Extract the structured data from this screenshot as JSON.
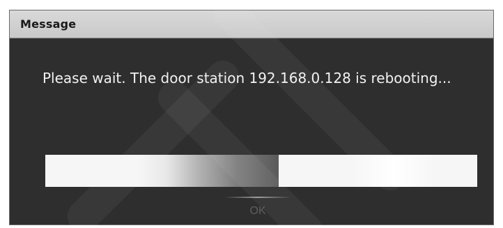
{
  "dialog": {
    "title": "Message",
    "message": "Please wait. The door station 192.168.0.128 is rebooting...",
    "progress": 0.54,
    "ok_label": "OK"
  },
  "colors": {
    "title_bar": "#d0d0d0",
    "body_background": "#2e2e2e",
    "message_text": "#f2f2f2",
    "progress_track": "#f6f6f6",
    "progress_fill_dark": "#5a5a5a",
    "ok_disabled_text": "#5e5e5e"
  }
}
